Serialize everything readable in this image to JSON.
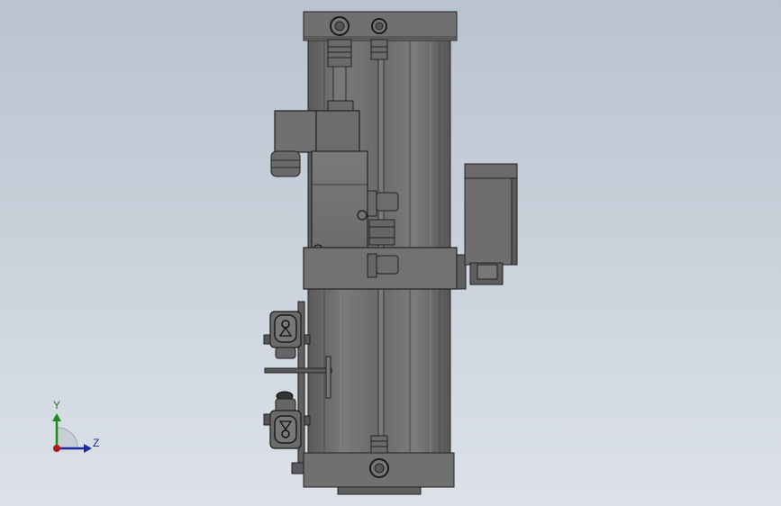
{
  "view": {
    "background_top": "#b9c3cf",
    "background_bottom": "#dde2e8",
    "part_color": "#6e6e6e",
    "part_dark": "#3a3a3a",
    "part_light": "#8c8c8c"
  },
  "triad": {
    "y_label": "Y",
    "z_label": "Z",
    "y_color": "#1b8a1b",
    "z_color": "#1a2aa0",
    "origin_color": "#b01818"
  },
  "model": {
    "name_icon": "pneumatic-cylinder-with-solenoid-valve"
  }
}
